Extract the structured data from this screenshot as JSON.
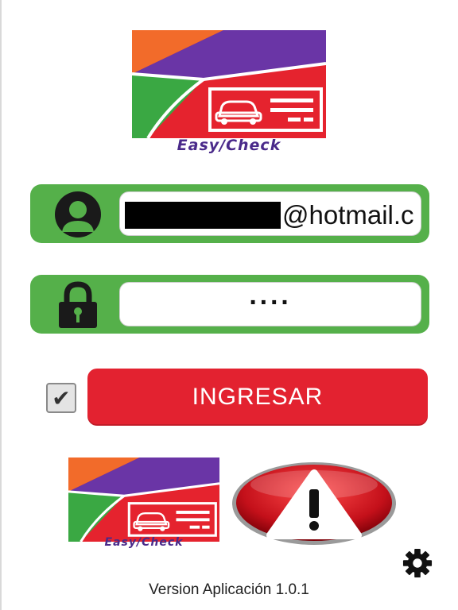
{
  "brand": {
    "name": "Easy/Check"
  },
  "login": {
    "email_value": "@hotmail.c",
    "password_value": "····",
    "remember_checked": true,
    "submit_label": "INGRESAR"
  },
  "footer": {
    "version_text": "Version Aplicación 1.0.1"
  },
  "icons": {
    "user": "user-icon",
    "lock": "lock-icon",
    "check": "checkmark-icon",
    "warning": "warning-icon",
    "settings": "gear-icon"
  },
  "colors": {
    "green": "#55b04a",
    "red": "#e32230",
    "logo_orange": "#f26b2a",
    "logo_purple": "#6a35a6",
    "logo_green": "#3aa843",
    "logo_red": "#e5232e"
  }
}
